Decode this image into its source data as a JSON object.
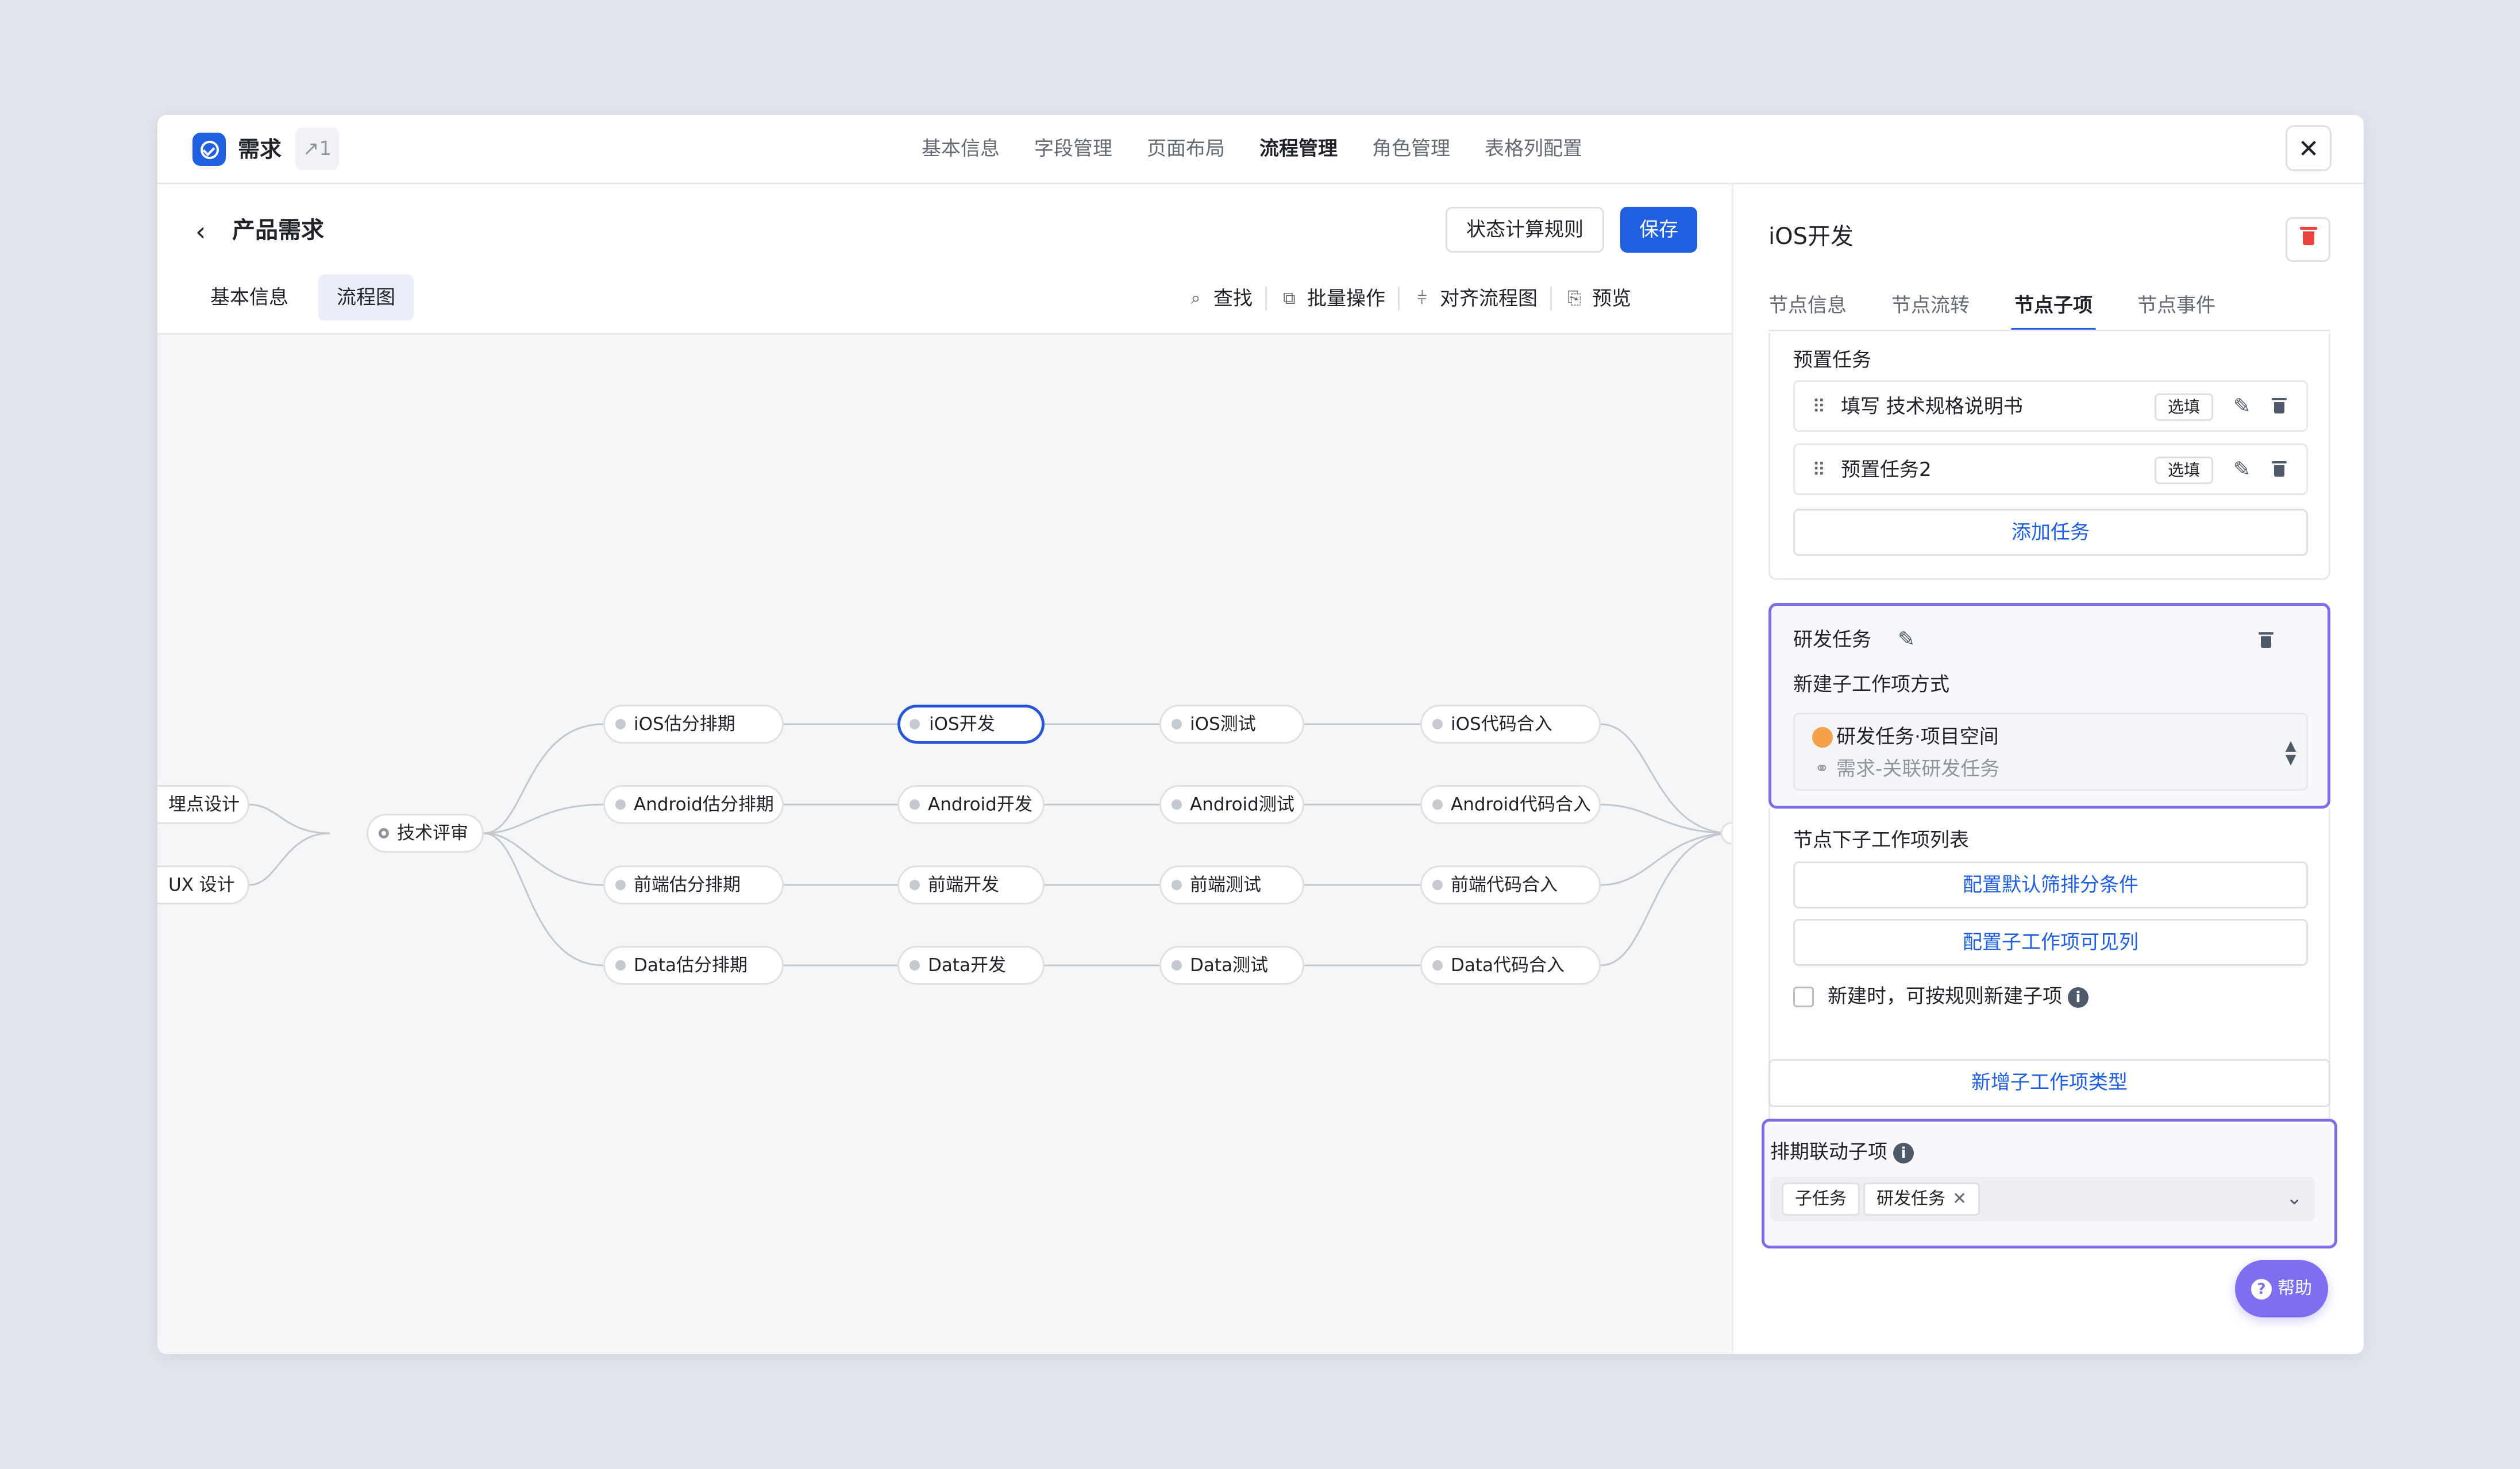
{
  "app": {
    "title": "需求",
    "badge": "↗1"
  },
  "top_tabs": [
    {
      "label": "基本信息"
    },
    {
      "label": "字段管理"
    },
    {
      "label": "页面布局"
    },
    {
      "label": "流程管理",
      "active": true
    },
    {
      "label": "角色管理"
    },
    {
      "label": "表格列配置"
    }
  ],
  "close_label": "✕",
  "page": {
    "title": "产品需求",
    "rule_button": "状态计算规则",
    "save_button": "保存"
  },
  "sub_tabs": [
    {
      "label": "基本信息"
    },
    {
      "label": "流程图",
      "active": true
    }
  ],
  "toolbar": {
    "find": "查找",
    "batch": "批量操作",
    "align": "对齐流程图",
    "preview": "预览"
  },
  "flow": {
    "left_nodes": [
      "埋点设计",
      "UX 设计"
    ],
    "center_node": "技术评审",
    "rows": [
      [
        "iOS估分排期",
        "iOS开发",
        "iOS测试",
        "iOS代码合入"
      ],
      [
        "Android估分排期",
        "Android开发",
        "Android测试",
        "Android代码合入"
      ],
      [
        "前端估分排期",
        "前端开发",
        "前端测试",
        "前端代码合入"
      ],
      [
        "Data估分排期",
        "Data开发",
        "Data测试",
        "Data代码合入"
      ]
    ],
    "selected": "iOS开发"
  },
  "panel": {
    "title": "iOS开发",
    "tabs": [
      {
        "label": "节点信息"
      },
      {
        "label": "节点流转"
      },
      {
        "label": "节点子项",
        "active": true
      },
      {
        "label": "节点事件"
      }
    ],
    "preset": {
      "label": "预置任务",
      "tasks": [
        {
          "text": "填写 技术规格说明书",
          "tag": "选填"
        },
        {
          "text": "预置任务2",
          "tag": "选填"
        }
      ],
      "add_button": "添加任务"
    },
    "dev": {
      "label": "研发任务",
      "create_label": "新建子工作项方式",
      "option_main": "研发任务·项目空间",
      "option_sub": "需求-关联研发任务",
      "list_label": "节点下子工作项列表",
      "btn_filter": "配置默认筛排分条件",
      "btn_visible": "配置子工作项可见列",
      "checkbox_label": "新建时，可按规则新建子项"
    },
    "add_type_button": "新增子工作项类型",
    "schedule": {
      "label": "排期联动子项",
      "chips": [
        "子任务",
        "研发任务"
      ]
    }
  },
  "help_label": "帮助",
  "colors": {
    "accent": "#1f5fe0",
    "focus_border": "#7c6ee8",
    "danger": "#e8433f",
    "help": "#7d6ff0"
  }
}
